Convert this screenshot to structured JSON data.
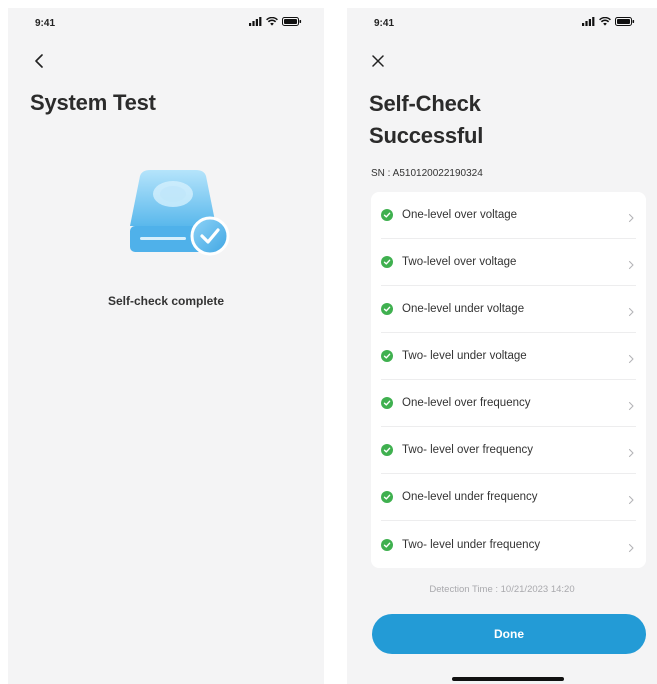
{
  "left_screen": {
    "status_time": "9:41",
    "title": "System Test",
    "caption": "Self-check complete"
  },
  "right_screen": {
    "status_time": "9:41",
    "title_line1": "Self-Check",
    "title_line2": "Successful",
    "serial": "SN : A510120022190324",
    "checks": [
      {
        "label": "One-level over voltage"
      },
      {
        "label": "Two-level over voltage"
      },
      {
        "label": "One-level under voltage"
      },
      {
        "label": "Two- level under voltage"
      },
      {
        "label": "One-level over frequency"
      },
      {
        "label": "Two- level over frequency"
      },
      {
        "label": "One-level under frequency"
      },
      {
        "label": "Two- level under frequency"
      }
    ],
    "detection_time": "Detection Time : 10/21/2023 14:20",
    "done_label": "Done"
  },
  "icons": {
    "back": "chevron-left-icon",
    "close": "close-icon",
    "check": "check-circle-icon",
    "row_chevron": "chevron-right-icon",
    "signal": "signal-icon",
    "wifi": "wifi-icon",
    "battery": "battery-icon",
    "illustration": "hard-drive-check-icon"
  },
  "colors": {
    "background": "#f4f4f5",
    "card": "#ffffff",
    "success": "#3fb04f",
    "primary_button": "#239bd6",
    "illustration_blue": "#6cc3f0"
  }
}
